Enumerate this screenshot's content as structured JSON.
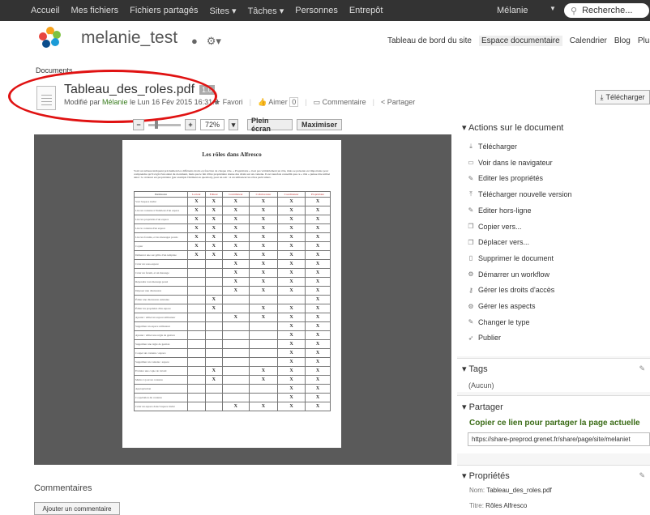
{
  "topbar": {
    "nav": [
      "Accueil",
      "Mes fichiers",
      "Fichiers partagés",
      "Sites ▾",
      "Tâches ▾",
      "Personnes",
      "Entrepôt"
    ],
    "user": "Mélanie",
    "search_placeholder": "Recherche..."
  },
  "site": {
    "name": "melanie_test",
    "nav": [
      "Tableau de bord du site",
      "Espace documentaire",
      "Calendrier",
      "Blog",
      "Plus ▾"
    ],
    "active_nav": "Espace documentaire"
  },
  "breadcrumb": "Documents",
  "document": {
    "title": "Tableau_des_roles.pdf",
    "version": "1.0",
    "modified_prefix": "Modifié par",
    "modified_by": "Mélanie",
    "modified_date": "le Lun 16 Fév 2015 16:31:0",
    "favorite": "Favori",
    "like": "Aimer",
    "like_count": "0",
    "comment": "Commentaire",
    "share": "Partager",
    "download": "Télécharger"
  },
  "viewer": {
    "zoom": "72%",
    "fullscreen": "Plein écran",
    "maximize": "Maximiser",
    "page_title": "Les rôles dans Alfresco",
    "intro": "Voici un tableau indiquant précisément les différents droits en fonction de chaque rôle. « Propriétaire » n'est pas véritablement un rôle, mais se présente est importante pour comprendre qu'il s'agit d'un statut du document, mais que le fait d'être propriétaire donne des droits sur un contenu. Il est toutefois conseillé que ce « rôle » puisse être utilisé ainsi : le créateur est propriétaire (par exemple l'élément en question), pour un soit : si un utilisateur les rôles particuliers.",
    "columns": [
      "Permission",
      "Lecteur",
      "Editeur",
      "Contributeur",
      "Collaborateur",
      "Coordinateur",
      "Propriétaire"
    ],
    "rows": [
      [
        "Voir l'espace invité",
        "X",
        "X",
        "X",
        "X",
        "X",
        "X"
      ],
      [
        "Lire un contenu à l'intérieur d'un espace",
        "X",
        "X",
        "X",
        "X",
        "X",
        "X"
      ],
      [
        "Lire les propriétés d'un espace",
        "X",
        "X",
        "X",
        "X",
        "X",
        "X"
      ],
      [
        "Lire le contenu d'un espace",
        "X",
        "X",
        "X",
        "X",
        "X",
        "X"
      ],
      [
        "Lire les forums, et les messages postés",
        "X",
        "X",
        "X",
        "X",
        "X",
        "X"
      ],
      [
        "Copier",
        "X",
        "X",
        "X",
        "X",
        "X",
        "X"
      ],
      [
        "Démarrer une sur grille d'un template",
        "X",
        "X",
        "X",
        "X",
        "X",
        "X"
      ],
      [
        "Créer un sous-espace",
        "",
        "",
        "X",
        "X",
        "X",
        "X"
      ],
      [
        "Créer un forum, et un message",
        "",
        "",
        "X",
        "X",
        "X",
        "X"
      ],
      [
        "Répondre à un message posté",
        "",
        "",
        "X",
        "X",
        "X",
        "X"
      ],
      [
        "Déposer une discussion",
        "",
        "",
        "X",
        "X",
        "X",
        "X"
      ],
      [
        "Éditer une discussion existante",
        "",
        "X",
        "",
        "",
        "",
        "X"
      ],
      [
        "Éditer les propriétés d'un espace",
        "",
        "X",
        "",
        "X",
        "X",
        "X"
      ],
      [
        "Ajouter / éditer un espace utilisateur",
        "",
        "",
        "X",
        "X",
        "X",
        "X"
      ],
      [
        "Supprimer un espace utilisateur",
        "",
        "",
        "",
        "",
        "X",
        "X"
      ],
      [
        "Ajouter / éditer une règle de gestion",
        "",
        "",
        "",
        "",
        "X",
        "X"
      ],
      [
        "Supprimer une règle de gestion",
        "",
        "",
        "",
        "",
        "X",
        "X"
      ],
      [
        "Couper un contenu / espace",
        "",
        "",
        "",
        "",
        "X",
        "X"
      ],
      [
        "Supprimer un contenu / espace",
        "",
        "",
        "",
        "",
        "X",
        "X"
      ],
      [
        "Extraire une copie de travail",
        "",
        "X",
        "",
        "X",
        "X",
        "X"
      ],
      [
        "Mettre à jour un contenu",
        "",
        "X",
        "",
        "X",
        "X",
        "X"
      ],
      [
        "Appropriation",
        "",
        "",
        "",
        "",
        "X",
        "X"
      ],
      [
        "Coopération du contenu",
        "",
        "",
        "",
        "",
        "X",
        "X"
      ],
      [
        "Créer un espace dans l'espace invité",
        "",
        "",
        "X",
        "X",
        "X",
        "X"
      ]
    ]
  },
  "comments": {
    "title": "Commentaires",
    "add": "Ajouter un commentaire"
  },
  "sidebar": {
    "actions_title": "▾ Actions sur le document",
    "actions": [
      {
        "label": "Télécharger",
        "icon": "download-icon"
      },
      {
        "label": "Voir dans le navigateur",
        "icon": "browser-view-icon"
      },
      {
        "label": "Editer les propriétés",
        "icon": "edit-properties-icon"
      },
      {
        "label": "Télécharger nouvelle version",
        "icon": "upload-icon"
      },
      {
        "label": "Editer hors-ligne",
        "icon": "pencil-icon"
      },
      {
        "label": "Copier vers...",
        "icon": "copy-icon"
      },
      {
        "label": "Déplacer vers...",
        "icon": "move-icon"
      },
      {
        "label": "Supprimer le document",
        "icon": "delete-icon"
      },
      {
        "label": "Démarrer un workflow",
        "icon": "workflow-icon"
      },
      {
        "label": "Gérer les droits d'accès",
        "icon": "key-icon"
      },
      {
        "label": "Gérer les aspects",
        "icon": "aspects-icon"
      },
      {
        "label": "Changer le type",
        "icon": "pencil-icon"
      },
      {
        "label": "Publier",
        "icon": "publish-icon"
      }
    ],
    "tags_title": "▾ Tags",
    "tags_value": "(Aucun)",
    "share_title": "▾ Partager",
    "share_link_label": "Copier ce lien pour partager la page actuelle",
    "share_url": "https://share-preprod.grenet.fr/share/page/site/melaniet",
    "props_title": "▾ Propriétés",
    "props": [
      {
        "label": "Nom:",
        "value": "Tableau_des_roles.pdf"
      },
      {
        "label": "Titre:",
        "value": "Rôles Alfresco"
      }
    ]
  }
}
